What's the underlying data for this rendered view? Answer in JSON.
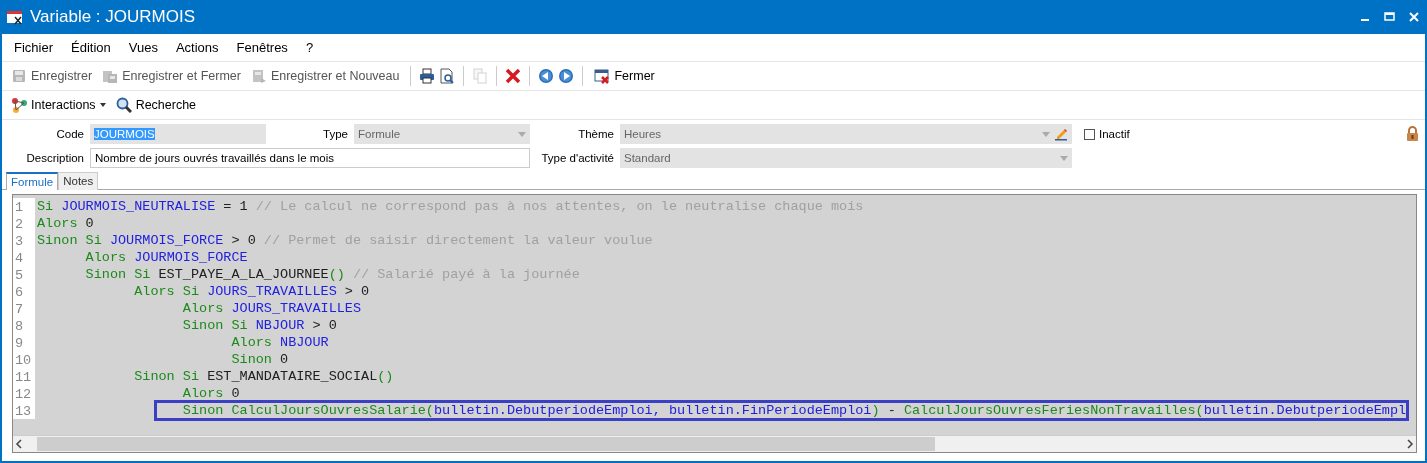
{
  "window": {
    "title": "Variable : JOURMOIS"
  },
  "menu": [
    "Fichier",
    "Édition",
    "Vues",
    "Actions",
    "Fenêtres",
    "?"
  ],
  "toolbar": [
    {
      "kind": "save",
      "label": "Enregistrer",
      "disabled": true
    },
    {
      "kind": "save-close",
      "label": "Enregistrer et Fermer",
      "disabled": true
    },
    {
      "kind": "save-new",
      "label": "Enregistrer et Nouveau",
      "disabled": true
    },
    {
      "kind": "sep"
    },
    {
      "kind": "print"
    },
    {
      "kind": "preview"
    },
    {
      "kind": "sep"
    },
    {
      "kind": "copy",
      "disabled": true
    },
    {
      "kind": "sep"
    },
    {
      "kind": "delete"
    },
    {
      "kind": "sep"
    },
    {
      "kind": "prev"
    },
    {
      "kind": "next"
    },
    {
      "kind": "sep"
    },
    {
      "kind": "close",
      "label": "Fermer",
      "disabled": false
    }
  ],
  "toolbar2": [
    {
      "kind": "interactions",
      "label": "Interactions"
    },
    {
      "kind": "search",
      "label": "Recherche"
    }
  ],
  "form": {
    "code_label": "Code",
    "code": "JOURMOIS",
    "type_label": "Type",
    "type": "Formule",
    "theme_label": "Thème",
    "theme": "Heures",
    "inactive_label": "Inactif",
    "inactive": false,
    "description_label": "Description",
    "description": "Nombre de jours ouvrés travaillés dans le mois",
    "activity_label": "Type d'activité",
    "activity": "Standard"
  },
  "tabs": [
    {
      "label": "Formule",
      "selected": true
    },
    {
      "label": "Notes",
      "selected": false
    }
  ],
  "code_lines": [
    {
      "number": "1",
      "highlighted": false,
      "tokens": [
        {
          "kind": "kw",
          "text": "Si"
        },
        {
          "kind": "id",
          "text": " JOURMOIS_NEUTRALISE"
        },
        {
          "kind": "op",
          "text": " = 1 "
        },
        {
          "kind": "comment",
          "text": "// Le calcul ne correspond pas à nos attentes, on le neutralise chaque mois"
        }
      ]
    },
    {
      "number": "2",
      "highlighted": false,
      "tokens": [
        {
          "kind": "kw",
          "text": "Alors"
        },
        {
          "kind": "op",
          "text": " 0"
        }
      ]
    },
    {
      "number": "3",
      "highlighted": false,
      "tokens": [
        {
          "kind": "kw",
          "text": "Sinon Si"
        },
        {
          "kind": "id",
          "text": " JOURMOIS_FORCE"
        },
        {
          "kind": "op",
          "text": " > 0 "
        },
        {
          "kind": "comment",
          "text": "// Permet de saisir directement la valeur voulue"
        }
      ]
    },
    {
      "number": "4",
      "highlighted": false,
      "tokens": [
        {
          "kind": "kw",
          "text": "      Alors"
        },
        {
          "kind": "id",
          "text": " JOURMOIS_FORCE"
        }
      ]
    },
    {
      "number": "5",
      "highlighted": false,
      "tokens": [
        {
          "kind": "kw",
          "text": "      Sinon Si"
        },
        {
          "kind": "op",
          "text": " EST_PAYE_A_LA_JOURNEE"
        },
        {
          "kind": "kw",
          "text": "()"
        },
        {
          "kind": "comment",
          "text": " // Salarié payé à la journée"
        }
      ]
    },
    {
      "number": "6",
      "highlighted": false,
      "tokens": [
        {
          "kind": "kw",
          "text": "            Alors Si"
        },
        {
          "kind": "id",
          "text": " JOURS_TRAVAILLES"
        },
        {
          "kind": "op",
          "text": " > 0"
        }
      ]
    },
    {
      "number": "7",
      "highlighted": false,
      "tokens": [
        {
          "kind": "kw",
          "text": "                  Alors"
        },
        {
          "kind": "id",
          "text": " JOURS_TRAVAILLES"
        }
      ]
    },
    {
      "number": "8",
      "highlighted": false,
      "tokens": [
        {
          "kind": "kw",
          "text": "                  Sinon Si"
        },
        {
          "kind": "id",
          "text": " NBJOUR"
        },
        {
          "kind": "op",
          "text": " > 0"
        }
      ]
    },
    {
      "number": "9",
      "highlighted": false,
      "tokens": [
        {
          "kind": "kw",
          "text": "                        Alors"
        },
        {
          "kind": "id",
          "text": " NBJOUR"
        }
      ]
    },
    {
      "number": "10",
      "highlighted": false,
      "tokens": [
        {
          "kind": "kw",
          "text": "                        Sinon"
        },
        {
          "kind": "op",
          "text": " 0"
        }
      ]
    },
    {
      "number": "11",
      "highlighted": false,
      "tokens": [
        {
          "kind": "kw",
          "text": "            Sinon Si"
        },
        {
          "kind": "op",
          "text": " EST_MANDATAIRE_SOCIAL"
        },
        {
          "kind": "kw",
          "text": "()"
        }
      ]
    },
    {
      "number": "12",
      "highlighted": false,
      "tokens": [
        {
          "kind": "kw",
          "text": "                  Alors"
        },
        {
          "kind": "op",
          "text": " 0"
        }
      ]
    },
    {
      "number": "13",
      "highlighted": true,
      "tokens": [
        {
          "kind": "kw",
          "text": "                  Sinon CalculJoursOuvresSalarie("
        },
        {
          "kind": "id",
          "text": "bulletin.DebutperiodeEmploi, bulletin.FinPeriodeEmploi"
        },
        {
          "kind": "kw",
          "text": ")"
        },
        {
          "kind": "op",
          "text": " - "
        },
        {
          "kind": "kw",
          "text": "CalculJoursOuvresFeriesNonTravailles("
        },
        {
          "kind": "id",
          "text": "bulletin.DebutperiodeEmpl"
        }
      ]
    }
  ]
}
